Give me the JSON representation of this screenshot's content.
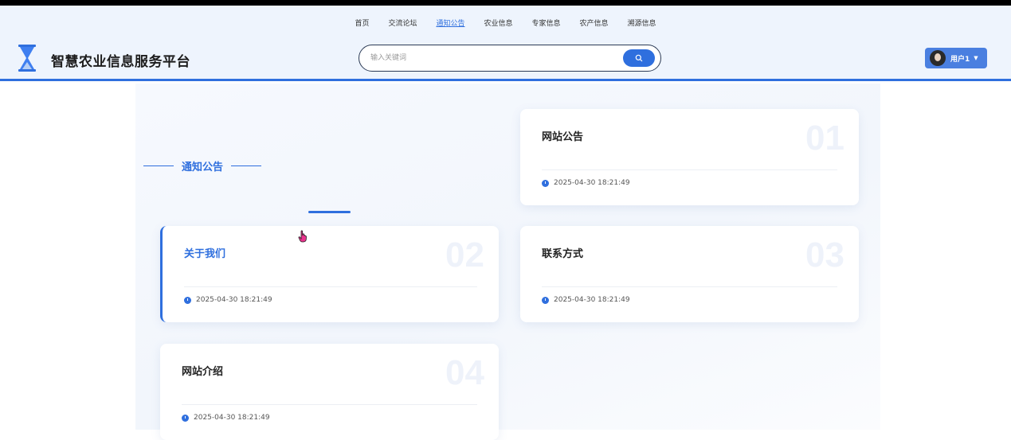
{
  "nav": {
    "items": [
      {
        "label": "首页",
        "active": false
      },
      {
        "label": "交流论坛",
        "active": false
      },
      {
        "label": "通知公告",
        "active": true
      },
      {
        "label": "农业信息",
        "active": false
      },
      {
        "label": "专家信息",
        "active": false
      },
      {
        "label": "农产信息",
        "active": false
      },
      {
        "label": "溯源信息",
        "active": false
      }
    ]
  },
  "header": {
    "site_title": "智慧农业信息服务平台",
    "logo_icon": "hourglass-icon"
  },
  "search": {
    "placeholder": "输入关键词",
    "value": ""
  },
  "user": {
    "name": "用户1",
    "avatar_icon": "user-avatar"
  },
  "section": {
    "title": "通知公告"
  },
  "notices": [
    {
      "title": "网站公告",
      "number": "01",
      "date": "2025-04-30 18:21:49"
    },
    {
      "title": "关于我们",
      "number": "02",
      "date": "2025-04-30 18:21:49"
    },
    {
      "title": "联系方式",
      "number": "03",
      "date": "2025-04-30 18:21:49"
    },
    {
      "title": "网站介绍",
      "number": "04",
      "date": "2025-04-30 18:21:49"
    }
  ],
  "colors": {
    "accent": "#2f6fde",
    "header_bg": "#eef4fd"
  }
}
